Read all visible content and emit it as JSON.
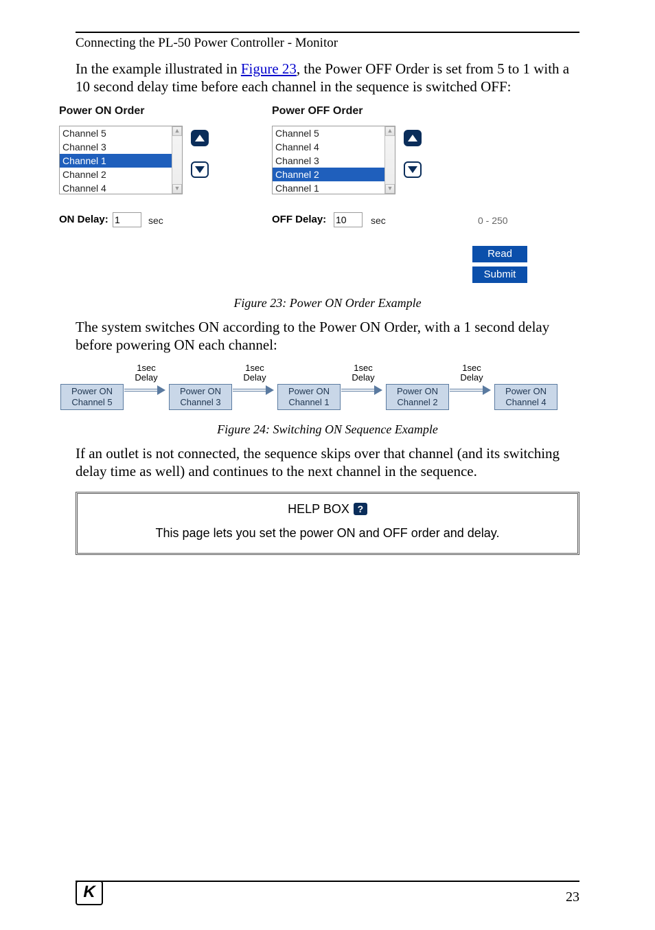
{
  "header": "Connecting the PL-50 Power Controller - Monitor",
  "para1_pre": "In the example illustrated in ",
  "para1_link": "Figure 23",
  "para1_post": ", the Power OFF Order is set from 5 to 1 with a 10 second delay time before each channel in the sequence is switched OFF:",
  "on_title": "Power ON Order",
  "off_title": "Power OFF Order",
  "on_list": [
    "Channel 5",
    "Channel 3",
    "Channel 1",
    "Channel 2",
    "Channel 4"
  ],
  "on_selected_index": 2,
  "off_list": [
    "Channel 5",
    "Channel 4",
    "Channel 3",
    "Channel 2",
    "Channel 1"
  ],
  "off_selected_index": 3,
  "on_delay_label": "ON Delay:",
  "on_delay_value": "1",
  "off_delay_label": "OFF Delay:",
  "off_delay_value": "10",
  "sec": "sec",
  "range_hint": "0 - 250",
  "read_btn": "Read",
  "submit_btn": "Submit",
  "caption23": "Figure 23: Power ON Order Example",
  "para2": "The system switches ON according to the Power ON Order, with a 1 second delay before powering ON each channel:",
  "seq_boxes": [
    {
      "l1": "Power ON",
      "l2": "Channel 5"
    },
    {
      "l1": "Power ON",
      "l2": "Channel 3"
    },
    {
      "l1": "Power ON",
      "l2": "Channel 1"
    },
    {
      "l1": "Power ON",
      "l2": "Channel 2"
    },
    {
      "l1": "Power ON",
      "l2": "Channel 4"
    }
  ],
  "seq_gap_l1": "1sec",
  "seq_gap_l2": "Delay",
  "caption24": "Figure 24: Switching ON Sequence Example",
  "para3": "If an outlet is not connected, the sequence skips over that channel (and its switching delay time as well) and continues to the next channel in the sequence.",
  "help_title": "HELP BOX",
  "help_icon": "?",
  "help_text": "This page lets you set the power ON and OFF order and delay.",
  "page_num": "23",
  "logo": "K"
}
